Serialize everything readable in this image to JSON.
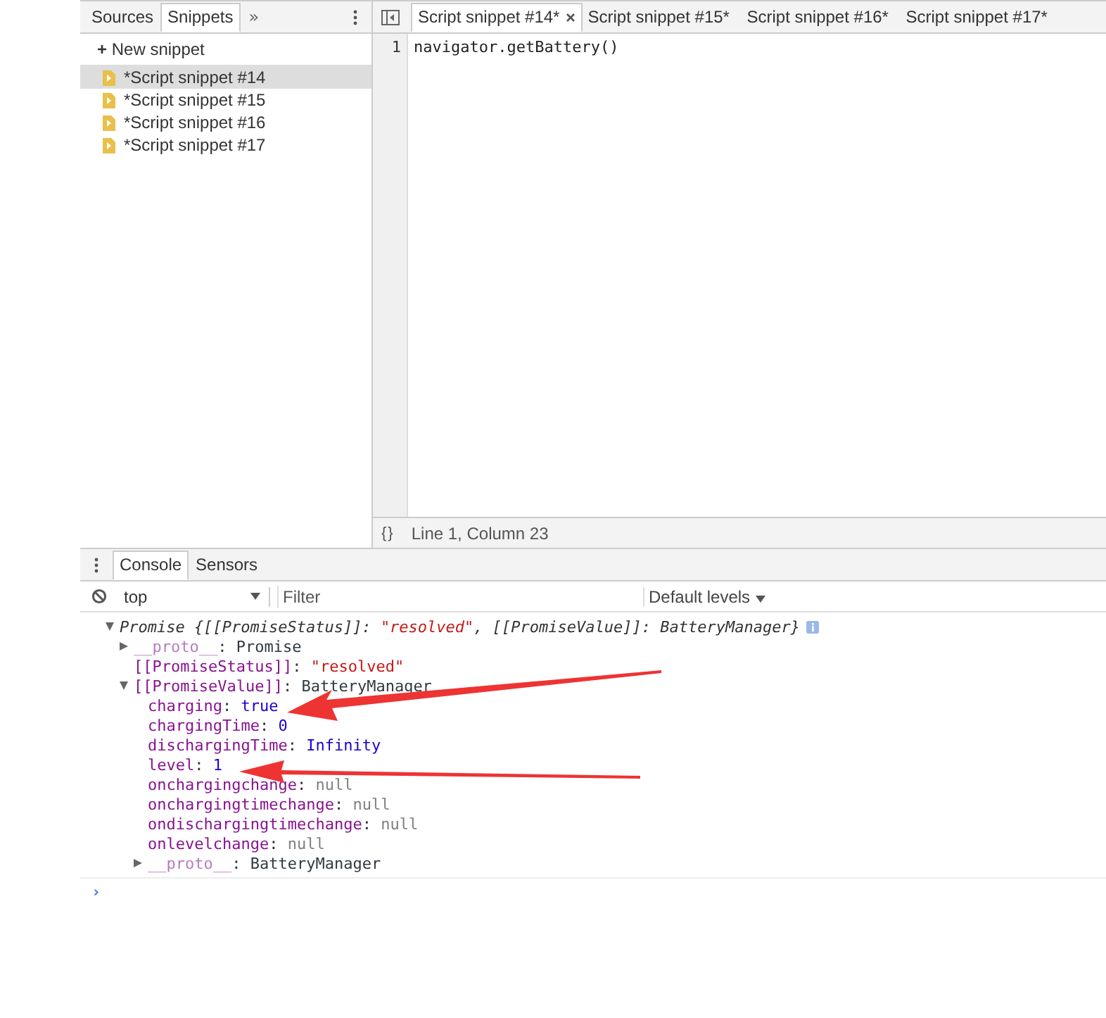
{
  "navigator": {
    "tabs": [
      {
        "label": "Sources",
        "selected": false
      },
      {
        "label": "Snippets",
        "selected": true
      }
    ],
    "more": "»",
    "new_snippet": {
      "icon": "+",
      "label": "New snippet"
    },
    "snippets": [
      {
        "name": "*Script snippet #14",
        "selected": true
      },
      {
        "name": "*Script snippet #15",
        "selected": false
      },
      {
        "name": "*Script snippet #16",
        "selected": false
      },
      {
        "name": "*Script snippet #17",
        "selected": false
      }
    ]
  },
  "editor": {
    "tabs": [
      {
        "label": "Script snippet #14*",
        "selected": true,
        "closable": true
      },
      {
        "label": "Script snippet #15*",
        "selected": false,
        "closable": false
      },
      {
        "label": "Script snippet #16*",
        "selected": false,
        "closable": false
      },
      {
        "label": "Script snippet #17*",
        "selected": false,
        "closable": false
      }
    ],
    "lines": [
      {
        "number": "1",
        "code": "navigator.getBattery()"
      }
    ],
    "status": {
      "format_icon": "{}",
      "position": "Line 1, Column 23"
    }
  },
  "drawer": {
    "tabs": [
      {
        "label": "Console",
        "selected": true
      },
      {
        "label": "Sensors",
        "selected": false
      }
    ],
    "context": "top",
    "filter_placeholder": "Filter",
    "levels": "Default levels"
  },
  "console": {
    "separator": ":",
    "root": {
      "parts": [
        {
          "text": "Promise {[[PromiseStatus]]: ",
          "kind": "plain"
        },
        {
          "text": "\"resolved\"",
          "kind": "string"
        },
        {
          "text": ", [[PromiseValue]]: BatteryManager}",
          "kind": "plain"
        }
      ],
      "expanded": true,
      "children": [
        {
          "key": "__proto__",
          "value": "Promise",
          "kind": "object",
          "expanded": false,
          "dim": true
        },
        {
          "key": "[[PromiseStatus]]",
          "value": "\"resolved\"",
          "kind": "string",
          "dim": false
        },
        {
          "key": "[[PromiseValue]]",
          "value": "BatteryManager",
          "kind": "object",
          "expanded": true,
          "dim": false,
          "children": [
            {
              "key": "charging",
              "value": "true",
              "kind": "literal",
              "dim": false
            },
            {
              "key": "chargingTime",
              "value": "0",
              "kind": "literal",
              "dim": false
            },
            {
              "key": "dischargingTime",
              "value": "Infinity",
              "kind": "literal",
              "dim": false
            },
            {
              "key": "level",
              "value": "1",
              "kind": "literal",
              "dim": false
            },
            {
              "key": "onchargingchange",
              "value": "null",
              "kind": "null",
              "dim": false
            },
            {
              "key": "onchargingtimechange",
              "value": "null",
              "kind": "null",
              "dim": false
            },
            {
              "key": "ondischargingtimechange",
              "value": "null",
              "kind": "null",
              "dim": false
            },
            {
              "key": "onlevelchange",
              "value": "null",
              "kind": "null",
              "dim": false
            },
            {
              "key": "__proto__",
              "value": "BatteryManager",
              "kind": "object",
              "expanded": false,
              "dim": true
            }
          ]
        }
      ]
    },
    "prompt": "›"
  }
}
